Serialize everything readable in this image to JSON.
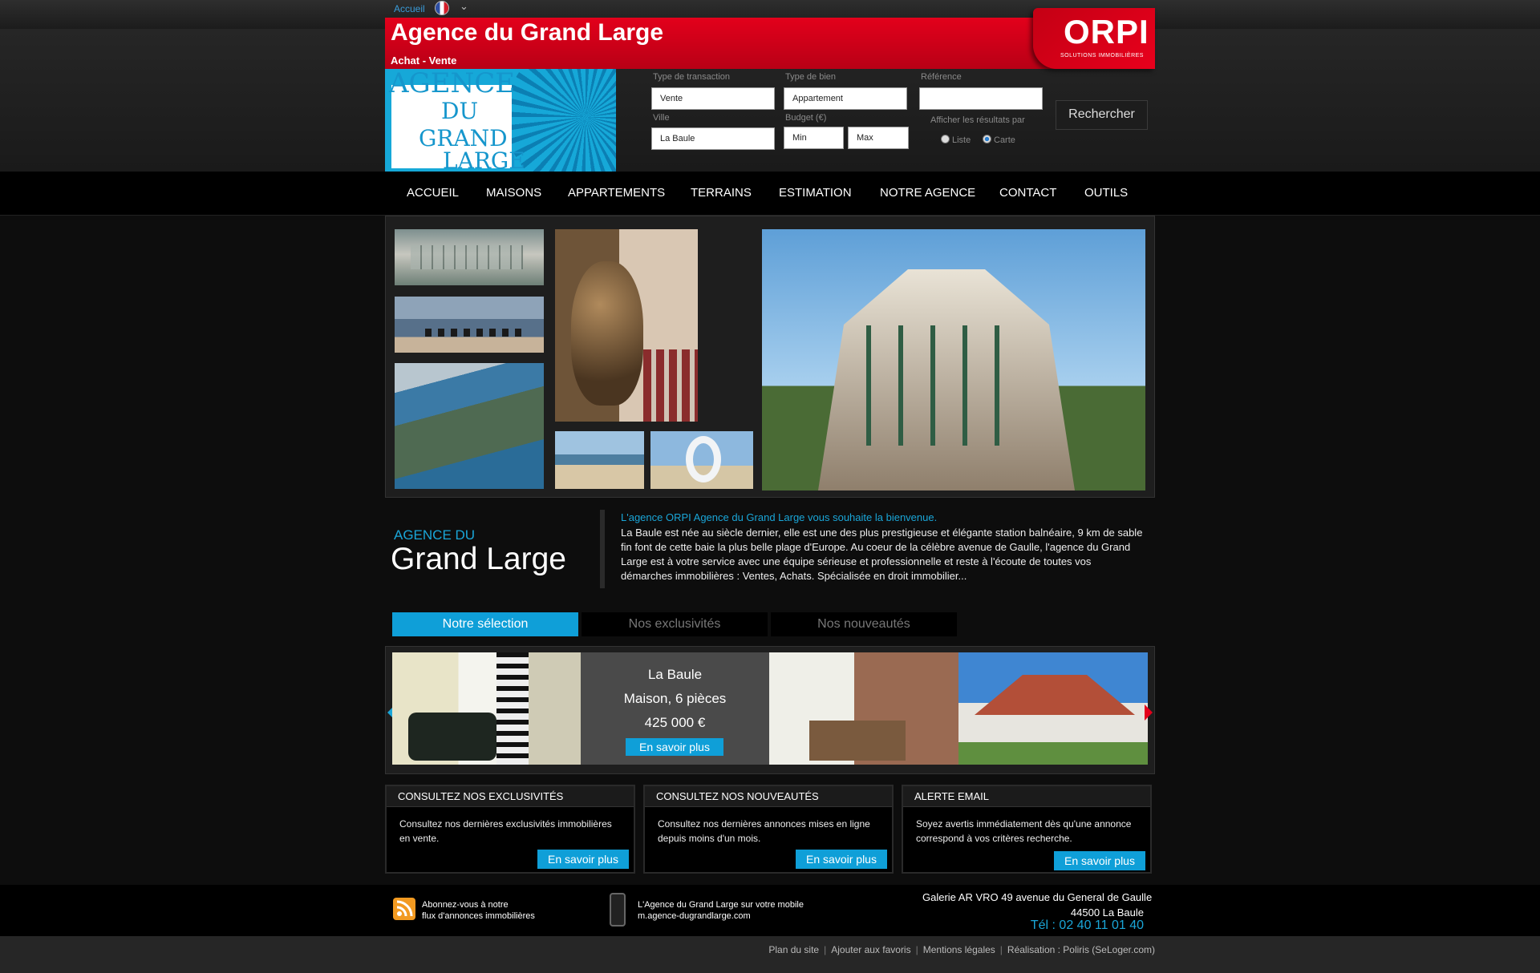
{
  "topnav": {
    "home": "Accueil"
  },
  "header": {
    "title": "Agence du Grand Large",
    "subtitle": "Achat - Vente"
  },
  "orpi": {
    "name": "ORPI",
    "tagline": "SOLUTIONS IMMOBILIÈRES"
  },
  "logo": {
    "line1": "AGENCE",
    "line2": "DU",
    "line3": "GRAND",
    "line4": "LARGE"
  },
  "search": {
    "transaction_label": "Type de transaction",
    "transaction_value": "Vente",
    "type_label": "Type de bien",
    "type_value": "Appartement",
    "reference_label": "Référence",
    "reference_value": "",
    "city_label": "Ville",
    "city_value": "La Baule",
    "budget_label": "Budget (€)",
    "budget_min": "Min",
    "budget_max": "Max",
    "display_label": "Afficher les résultats par",
    "option_list": "Liste",
    "option_map": "Carte",
    "button": "Rechercher"
  },
  "nav": [
    "ACCUEIL",
    "MAISONS",
    "APPARTEMENTS",
    "TERRAINS",
    "ESTIMATION",
    "NOTRE AGENCE",
    "CONTACT",
    "OUTILS"
  ],
  "welcome": {
    "head1": "AGENCE DU",
    "head2": "Grand Large",
    "lead": "L'agence ORPI Agence du Grand Large vous souhaite la bienvenue.",
    "body": "La Baule est née au siècle dernier, elle est une des plus prestigieuse et élégante station balnéaire, 9 km de sable fin font de cette baie la plus belle plage d'Europe. Au coeur de la célèbre avenue de Gaulle, l'agence du Grand Large est à votre service avec une équipe sérieuse et professionnelle et reste à l'écoute de toutes vos démarches immobilières : Ventes, Achats. Spécialisée en droit immobilier..."
  },
  "tabs": [
    "Notre sélection",
    "Nos exclusivités",
    "Nos nouveautés"
  ],
  "featured": {
    "city": "La Baule",
    "type": "Maison, 6 pièces",
    "price": "425 000 €",
    "cta": "En savoir plus"
  },
  "promos": [
    {
      "title": "CONSULTEZ NOS EXCLUSIVITÉS",
      "text": "Consultez nos dernières exclusivités immobilières en vente.",
      "cta": "En savoir plus"
    },
    {
      "title": "CONSULTEZ NOS NOUVEAUTÉS",
      "text": "Consultez nos dernières annonces mises en ligne depuis moins d'un mois.",
      "cta": "En savoir plus"
    },
    {
      "title": "ALERTE EMAIL",
      "text": "Soyez avertis immédiatement dès qu'une annonce correspond à vos critères recherche.",
      "cta": "En savoir plus"
    }
  ],
  "footer": {
    "rss_line1": "Abonnez-vous à notre",
    "rss_line2": "flux d'annonces immobilières",
    "mobile_line1": "L'Agence du Grand Large sur votre mobile",
    "mobile_line2": "m.agence-dugrandlarge.com",
    "addr_line1": "Galerie AR VRO  49 avenue du General de Gaulle",
    "addr_line2": "44500 La Baule",
    "tel": "Tél : 02 40 11 01 40",
    "links": [
      "Plan du site",
      "Ajouter aux favoris",
      "Mentions légales",
      "Réalisation : Poliris (SeLoger.com)"
    ]
  },
  "colors": {
    "brand_red": "#e3001b",
    "accent_blue": "#1aa6d8",
    "button_blue": "#0f9fd8",
    "background": "#0d0d0d"
  }
}
